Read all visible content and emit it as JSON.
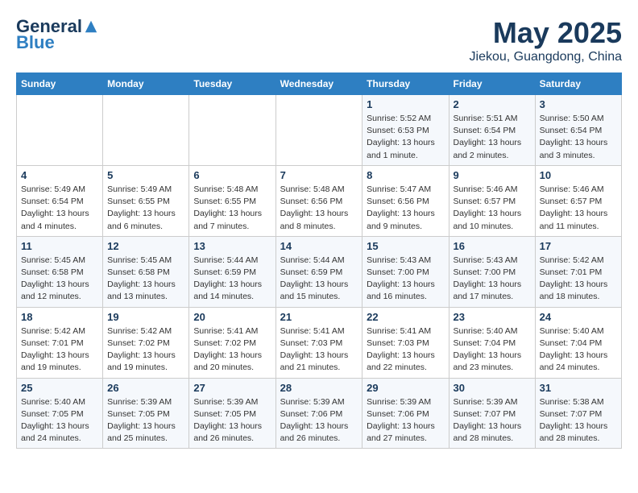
{
  "header": {
    "logo_general": "General",
    "logo_blue": "Blue",
    "title": "May 2025",
    "subtitle": "Jiekou, Guangdong, China"
  },
  "weekdays": [
    "Sunday",
    "Monday",
    "Tuesday",
    "Wednesday",
    "Thursday",
    "Friday",
    "Saturday"
  ],
  "weeks": [
    [
      {
        "day": "",
        "info": ""
      },
      {
        "day": "",
        "info": ""
      },
      {
        "day": "",
        "info": ""
      },
      {
        "day": "",
        "info": ""
      },
      {
        "day": "1",
        "info": "Sunrise: 5:52 AM\nSunset: 6:53 PM\nDaylight: 13 hours and 1 minute."
      },
      {
        "day": "2",
        "info": "Sunrise: 5:51 AM\nSunset: 6:54 PM\nDaylight: 13 hours and 2 minutes."
      },
      {
        "day": "3",
        "info": "Sunrise: 5:50 AM\nSunset: 6:54 PM\nDaylight: 13 hours and 3 minutes."
      }
    ],
    [
      {
        "day": "4",
        "info": "Sunrise: 5:49 AM\nSunset: 6:54 PM\nDaylight: 13 hours and 4 minutes."
      },
      {
        "day": "5",
        "info": "Sunrise: 5:49 AM\nSunset: 6:55 PM\nDaylight: 13 hours and 6 minutes."
      },
      {
        "day": "6",
        "info": "Sunrise: 5:48 AM\nSunset: 6:55 PM\nDaylight: 13 hours and 7 minutes."
      },
      {
        "day": "7",
        "info": "Sunrise: 5:48 AM\nSunset: 6:56 PM\nDaylight: 13 hours and 8 minutes."
      },
      {
        "day": "8",
        "info": "Sunrise: 5:47 AM\nSunset: 6:56 PM\nDaylight: 13 hours and 9 minutes."
      },
      {
        "day": "9",
        "info": "Sunrise: 5:46 AM\nSunset: 6:57 PM\nDaylight: 13 hours and 10 minutes."
      },
      {
        "day": "10",
        "info": "Sunrise: 5:46 AM\nSunset: 6:57 PM\nDaylight: 13 hours and 11 minutes."
      }
    ],
    [
      {
        "day": "11",
        "info": "Sunrise: 5:45 AM\nSunset: 6:58 PM\nDaylight: 13 hours and 12 minutes."
      },
      {
        "day": "12",
        "info": "Sunrise: 5:45 AM\nSunset: 6:58 PM\nDaylight: 13 hours and 13 minutes."
      },
      {
        "day": "13",
        "info": "Sunrise: 5:44 AM\nSunset: 6:59 PM\nDaylight: 13 hours and 14 minutes."
      },
      {
        "day": "14",
        "info": "Sunrise: 5:44 AM\nSunset: 6:59 PM\nDaylight: 13 hours and 15 minutes."
      },
      {
        "day": "15",
        "info": "Sunrise: 5:43 AM\nSunset: 7:00 PM\nDaylight: 13 hours and 16 minutes."
      },
      {
        "day": "16",
        "info": "Sunrise: 5:43 AM\nSunset: 7:00 PM\nDaylight: 13 hours and 17 minutes."
      },
      {
        "day": "17",
        "info": "Sunrise: 5:42 AM\nSunset: 7:01 PM\nDaylight: 13 hours and 18 minutes."
      }
    ],
    [
      {
        "day": "18",
        "info": "Sunrise: 5:42 AM\nSunset: 7:01 PM\nDaylight: 13 hours and 19 minutes."
      },
      {
        "day": "19",
        "info": "Sunrise: 5:42 AM\nSunset: 7:02 PM\nDaylight: 13 hours and 19 minutes."
      },
      {
        "day": "20",
        "info": "Sunrise: 5:41 AM\nSunset: 7:02 PM\nDaylight: 13 hours and 20 minutes."
      },
      {
        "day": "21",
        "info": "Sunrise: 5:41 AM\nSunset: 7:03 PM\nDaylight: 13 hours and 21 minutes."
      },
      {
        "day": "22",
        "info": "Sunrise: 5:41 AM\nSunset: 7:03 PM\nDaylight: 13 hours and 22 minutes."
      },
      {
        "day": "23",
        "info": "Sunrise: 5:40 AM\nSunset: 7:04 PM\nDaylight: 13 hours and 23 minutes."
      },
      {
        "day": "24",
        "info": "Sunrise: 5:40 AM\nSunset: 7:04 PM\nDaylight: 13 hours and 24 minutes."
      }
    ],
    [
      {
        "day": "25",
        "info": "Sunrise: 5:40 AM\nSunset: 7:05 PM\nDaylight: 13 hours and 24 minutes."
      },
      {
        "day": "26",
        "info": "Sunrise: 5:39 AM\nSunset: 7:05 PM\nDaylight: 13 hours and 25 minutes."
      },
      {
        "day": "27",
        "info": "Sunrise: 5:39 AM\nSunset: 7:05 PM\nDaylight: 13 hours and 26 minutes."
      },
      {
        "day": "28",
        "info": "Sunrise: 5:39 AM\nSunset: 7:06 PM\nDaylight: 13 hours and 26 minutes."
      },
      {
        "day": "29",
        "info": "Sunrise: 5:39 AM\nSunset: 7:06 PM\nDaylight: 13 hours and 27 minutes."
      },
      {
        "day": "30",
        "info": "Sunrise: 5:39 AM\nSunset: 7:07 PM\nDaylight: 13 hours and 28 minutes."
      },
      {
        "day": "31",
        "info": "Sunrise: 5:38 AM\nSunset: 7:07 PM\nDaylight: 13 hours and 28 minutes."
      }
    ]
  ]
}
